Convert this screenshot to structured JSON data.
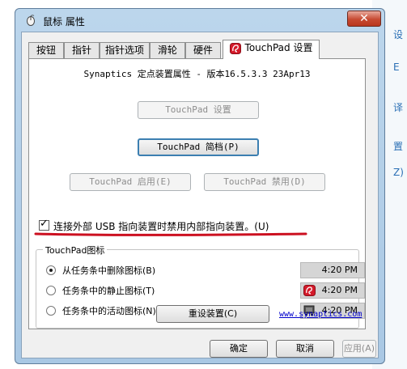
{
  "background": {
    "right_glyphs": [
      "设",
      "E",
      "译",
      "置",
      "Z)"
    ]
  },
  "window": {
    "title": "鼠标 属性",
    "close_label": "✕"
  },
  "tabs": [
    {
      "label": "按钮"
    },
    {
      "label": "指针"
    },
    {
      "label": "指针选项"
    },
    {
      "label": "滑轮"
    },
    {
      "label": "硬件"
    },
    {
      "label": "TouchPad 设置",
      "active": true
    }
  ],
  "panel": {
    "version": "Synaptics 定点装置属性 - 版本16.5.3.3 23Apr13",
    "touchpad_settings_button": "TouchPad 设置",
    "touchpad_profile_button": "TouchPad 简档(P)",
    "enable_button": "TouchPad 启用(E)",
    "disable_button": "TouchPad 禁用(D)",
    "disable_checkbox_label": "连接外部 USB 指向装置时禁用内部指向装置。(U)",
    "disable_checkbox_checked": true,
    "icon_group": {
      "title": "TouchPad图标",
      "options": [
        {
          "label": "从任务条中删除图标(B)",
          "checked": true,
          "time": "4:20 PM",
          "icon": "none"
        },
        {
          "label": "任务条中的静止图标(T)",
          "checked": false,
          "time": "4:20 PM",
          "icon": "touchpad-static-icon"
        },
        {
          "label": "任务条中的活动图标(N)",
          "checked": false,
          "time": "4:20 PM",
          "icon": "touchpad-animated-icon"
        }
      ]
    },
    "reset_button": "重设装置(C)",
    "link": "www.synaptics.com"
  },
  "footer": {
    "ok": "确定",
    "cancel": "取消",
    "apply": "应用(A)"
  },
  "colors": {
    "accent_red": "#cc1020",
    "link_blue": "#0000cc"
  }
}
